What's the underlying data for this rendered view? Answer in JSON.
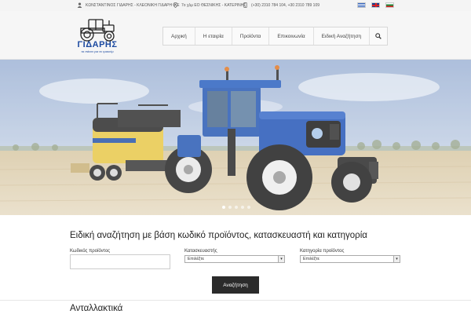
{
  "topbar": {
    "company": "ΚΩΝΣΤΑΝΤΙΝΟΣ ΓΙΔΑΡΗΣ - ΚΛΕΟΝΙΚΗ ΓΙΔΑΡΗ ΙΚΕ",
    "address": "7ο χλμ ΕΟ ΘΕΣΝΙΚΗΣ - ΚΑΤΕΡΙΝΗΣ",
    "phones": "(+30) 2310 784 104, +30 2310 789 109",
    "flags": [
      "gr",
      "uk",
      "bg"
    ]
  },
  "header": {
    "logo_title": "ΓΙΔΑΡΗΣ",
    "logo_tagline": "τα πάντα για το τρακτέρ",
    "nav": [
      "Αρχική",
      "Η εταιρία",
      "Προϊόντα",
      "Επικοινωνία",
      "Ειδική Αναζήτηση"
    ],
    "search_icon": "search-icon"
  },
  "hero": {
    "slides": 5,
    "active_slide": 0
  },
  "search": {
    "title": "Ειδική αναζήτηση με βάση κωδικό προϊόντος, κατασκευαστή και κατηγορία",
    "code_label": "Κωδικός προϊόντος",
    "code_value": "",
    "manufacturer_label": "Κατασκευαστής",
    "manufacturer_selected": "Επιλέξτε",
    "category_label": "Κατηγορία προϊόντος",
    "category_selected": "Επιλέξτε",
    "button": "Αναζήτηση"
  },
  "sections": {
    "spare_parts": "Ανταλλακτικά"
  }
}
